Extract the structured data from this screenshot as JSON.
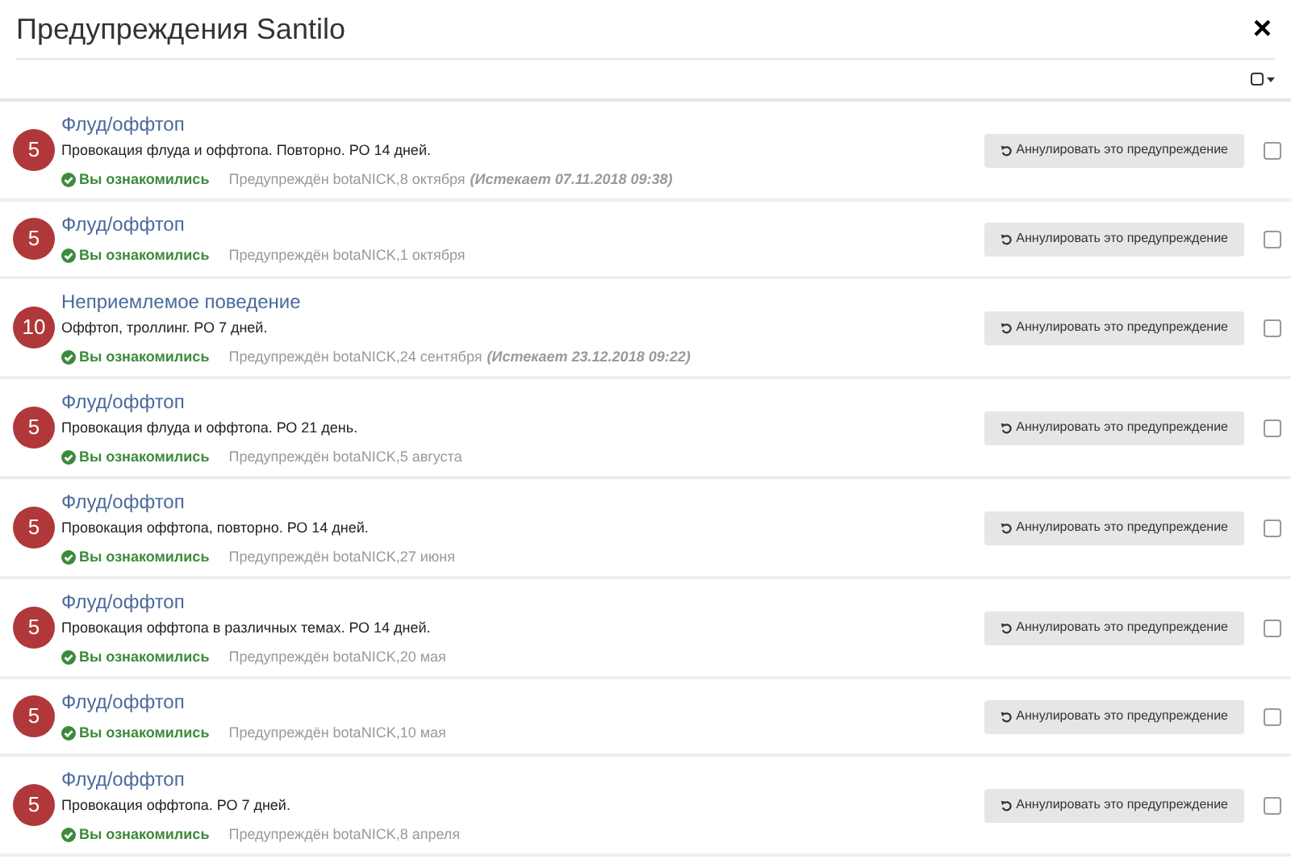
{
  "title": "Предупреждения Santilo",
  "close": "×",
  "select_all": {
    "checked": false
  },
  "warnings": [
    {
      "points": "5",
      "title": "Флуд/оффтоп",
      "description": "Провокация флуда и оффтопа. Повторно. РО 14 дней.",
      "acknowledged": "Вы ознакомились",
      "issued": "Предупреждён botaNICK,8 октября",
      "expires": "(Истекает 07.11.2018 09:38)",
      "button": "Аннулировать это предупреждение",
      "checked": false
    },
    {
      "points": "5",
      "title": "Флуд/оффтоп",
      "acknowledged": "Вы ознакомились",
      "issued": "Предупреждён botaNICK,1 октября",
      "button": "Аннулировать это предупреждение",
      "checked": false
    },
    {
      "points": "10",
      "title": "Неприемлемое поведение",
      "description": "Оффтоп, троллинг. РО 7 дней.",
      "acknowledged": "Вы ознакомились",
      "issued": "Предупреждён botaNICK,24 сентября",
      "expires": "(Истекает 23.12.2018 09:22)",
      "button": "Аннулировать это предупреждение",
      "checked": false
    },
    {
      "points": "5",
      "title": "Флуд/оффтоп",
      "description": "Провокация флуда и оффтопа. РО 21 день.",
      "acknowledged": "Вы ознакомились",
      "issued": "Предупреждён botaNICK,5 августа",
      "button": "Аннулировать это предупреждение",
      "checked": false
    },
    {
      "points": "5",
      "title": "Флуд/оффтоп",
      "description": "Провокация оффтопа, повторно. РО 14 дней.",
      "acknowledged": "Вы ознакомились",
      "issued": "Предупреждён botaNICK,27 июня",
      "button": "Аннулировать это предупреждение",
      "checked": false
    },
    {
      "points": "5",
      "title": "Флуд/оффтоп",
      "description": "Провокация оффтопа в различных темах. РО 14 дней.",
      "acknowledged": "Вы ознакомились",
      "issued": "Предупреждён botaNICK,20 мая",
      "button": "Аннулировать это предупреждение",
      "checked": false
    },
    {
      "points": "5",
      "title": "Флуд/оффтоп",
      "acknowledged": "Вы ознакомились",
      "issued": "Предупреждён botaNICK,10 мая",
      "button": "Аннулировать это предупреждение",
      "checked": false
    },
    {
      "points": "5",
      "title": "Флуд/оффтоп",
      "description": "Провокация оффтопа. РО 7 дней.",
      "acknowledged": "Вы ознакомились",
      "issued": "Предупреждён botaNICK,8 апреля",
      "button": "Аннулировать это предупреждение",
      "checked": false
    }
  ]
}
